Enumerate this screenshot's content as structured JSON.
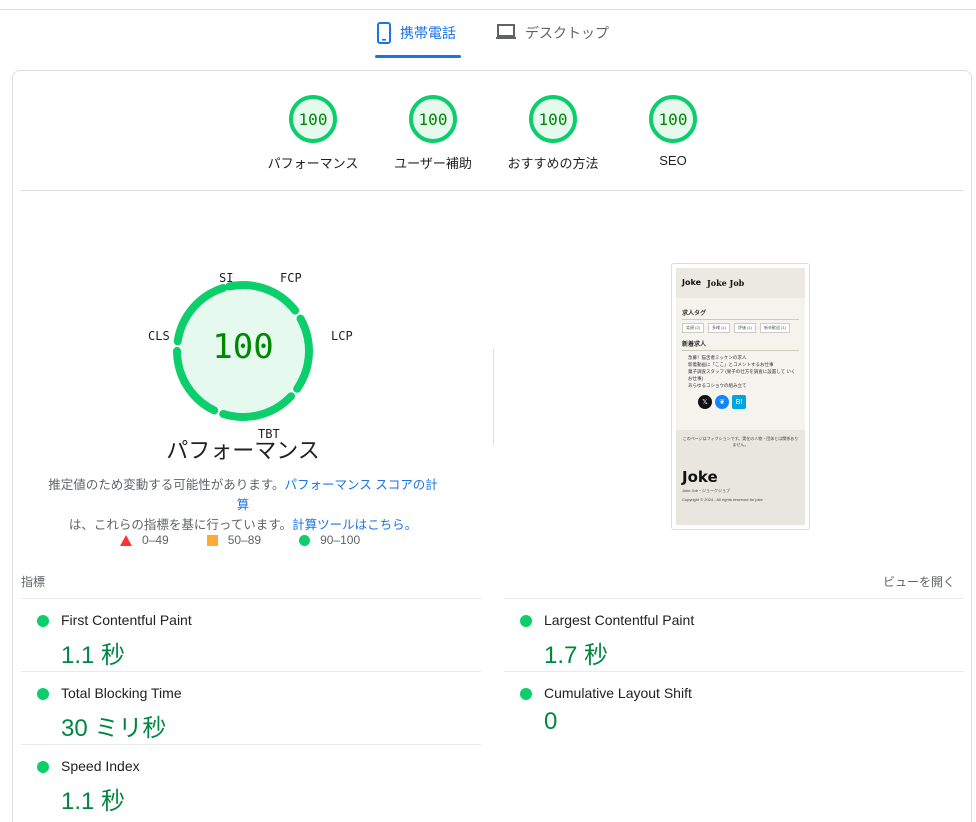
{
  "tabs": {
    "mobile": {
      "label": "携帯電話",
      "icon": "mobile-phone-icon",
      "selected": true
    },
    "desktop": {
      "label": "デスクトップ",
      "icon": "laptop-icon",
      "selected": false
    }
  },
  "summary": [
    {
      "score": "100",
      "label": "パフォーマンス"
    },
    {
      "score": "100",
      "label": "ユーザー補助"
    },
    {
      "score": "100",
      "label": "おすすめの方法"
    },
    {
      "score": "100",
      "label": "SEO"
    }
  ],
  "performance": {
    "score": "100",
    "score_value": 100,
    "title": "パフォーマンス",
    "gauge_labels": {
      "si": "SI",
      "fcp": "FCP",
      "lcp": "LCP",
      "tbt": "TBT",
      "cls": "CLS"
    },
    "desc_part1": "推定値のため変動する可能性があります。",
    "link_score_calc": "パフォーマンス スコアの計算",
    "desc_part2": "は、これらの指標を基に行っています。",
    "link_calculator": "計算ツールはこちら。"
  },
  "legend": {
    "fail": "0–49",
    "average": "50–89",
    "pass": "90–100"
  },
  "colors": {
    "pass": "#0cce6b",
    "average": "#ffaa33",
    "fail": "#ff3333",
    "accent": "#1a73e8",
    "value_green": "#018642"
  },
  "screenshot": {
    "site_logo": "Joke",
    "site_title": "Joke Job",
    "section_tags": "求人タグ",
    "tags": [
      "笑顔 (2)",
      "多様 (1)",
      "評価 (1)",
      "新卒歓迎 (1)"
    ],
    "section_new": "新着求人",
    "jobs": [
      "急募！猫舌者ミッケンの求人",
      "新着動画に「ここ」とコメントするお仕事",
      "菓子調査スタッフ (果子の仕方を調査に設置して いくお仕事)",
      "あらゆるコショウの組み立て"
    ],
    "footer_note": "このページはフィクションです。実在の人物・団体とは関係ありません。",
    "footer_logo": "Joke",
    "footer_name": "Joke Job・ジョークジョブ",
    "footer_copy": "Copyright © 2024 - All rights reserved for joke"
  },
  "metrics": {
    "heading": "指標",
    "expand": "ビューを開く",
    "items": [
      {
        "name": "First Contentful Paint",
        "value": "1.1 秒"
      },
      {
        "name": "Largest Contentful Paint",
        "value": "1.7 秒"
      },
      {
        "name": "Total Blocking Time",
        "value": "30 ミリ秒"
      },
      {
        "name": "Cumulative Layout Shift",
        "value": "0"
      },
      {
        "name": "Speed Index",
        "value": "1.1 秒"
      }
    ]
  }
}
